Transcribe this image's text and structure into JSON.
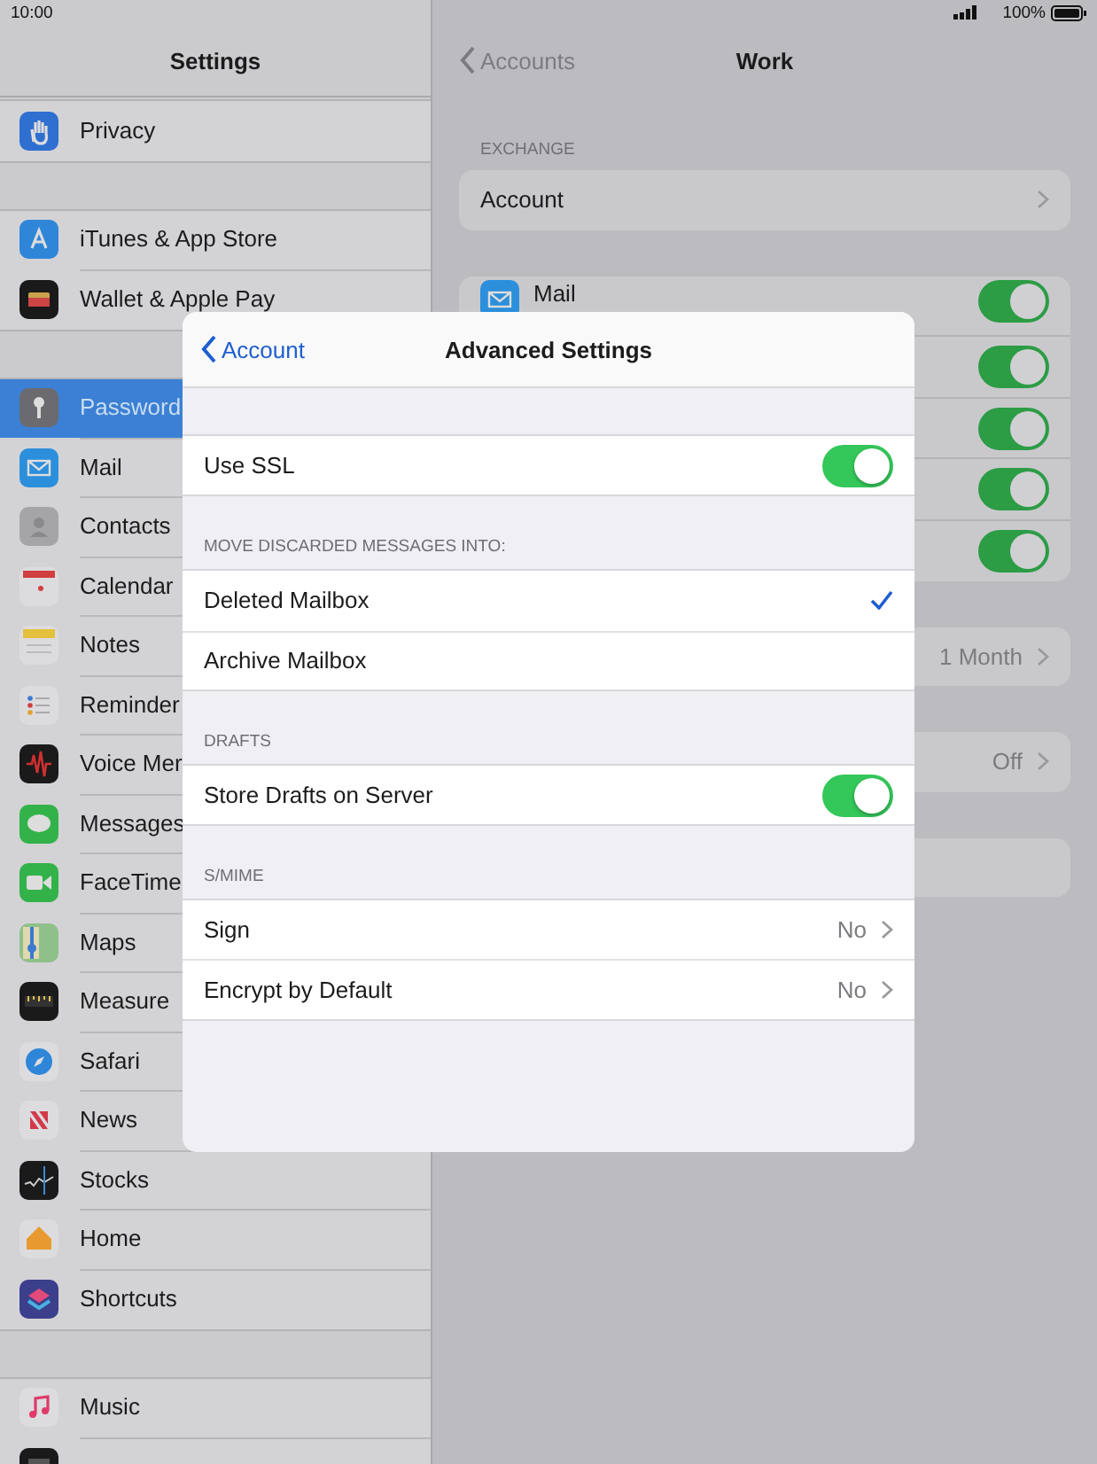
{
  "status_bar": {
    "time": "10:00",
    "battery": "100%"
  },
  "sidebar": {
    "title": "Settings",
    "groups": [
      {
        "items": [
          {
            "label": "Privacy",
            "selected": false
          }
        ]
      },
      {
        "items": [
          {
            "label": "iTunes & App Store",
            "selected": false
          },
          {
            "label": "Wallet & Apple Pay",
            "selected": false
          }
        ]
      },
      {
        "items": [
          {
            "label": "Password",
            "selected": true
          },
          {
            "label": "Mail",
            "selected": false
          },
          {
            "label": "Contacts",
            "selected": false
          },
          {
            "label": "Calendar",
            "selected": false
          },
          {
            "label": "Notes",
            "selected": false
          },
          {
            "label": "Reminder",
            "selected": false
          },
          {
            "label": "Voice Mer",
            "selected": false
          },
          {
            "label": "Messages",
            "selected": false
          },
          {
            "label": "FaceTime",
            "selected": false
          },
          {
            "label": "Maps",
            "selected": false
          },
          {
            "label": "Measure",
            "selected": false
          },
          {
            "label": "Safari",
            "selected": false
          },
          {
            "label": "News",
            "selected": false
          },
          {
            "label": "Stocks",
            "selected": false
          },
          {
            "label": "Home",
            "selected": false
          },
          {
            "label": "Shortcuts",
            "selected": false
          }
        ]
      },
      {
        "items": [
          {
            "label": "Music",
            "selected": false
          },
          {
            "selected": false
          }
        ]
      }
    ]
  },
  "detail": {
    "back": "Accounts",
    "title": "Work",
    "section_header": "EXCHANGE",
    "account_row": {
      "label": "Account"
    },
    "toggle_rows": [
      {
        "label": "Mail",
        "on": true
      },
      {
        "on": true
      },
      {
        "on": true
      },
      {
        "on": true
      },
      {
        "on": true
      }
    ],
    "value_rows": [
      {
        "value": "1 Month"
      },
      {
        "value": "Off"
      },
      {}
    ]
  },
  "modal": {
    "back": "Account",
    "title": "Advanced Settings",
    "sections": [
      {
        "rows": [
          {
            "kind": "toggle",
            "label": "Use SSL",
            "on": true
          }
        ]
      },
      {
        "header": "MOVE DISCARDED MESSAGES INTO:",
        "rows": [
          {
            "kind": "option",
            "label": "Deleted Mailbox",
            "selected": true
          },
          {
            "kind": "option",
            "label": "Archive Mailbox",
            "selected": false
          }
        ]
      },
      {
        "header": "DRAFTS",
        "rows": [
          {
            "kind": "toggle",
            "label": "Store Drafts on Server",
            "on": true
          }
        ]
      },
      {
        "header": "S/MIME",
        "rows": [
          {
            "kind": "value",
            "label": "Sign",
            "value": "No"
          },
          {
            "kind": "value",
            "label": "Encrypt by Default",
            "value": "No"
          }
        ]
      }
    ]
  }
}
